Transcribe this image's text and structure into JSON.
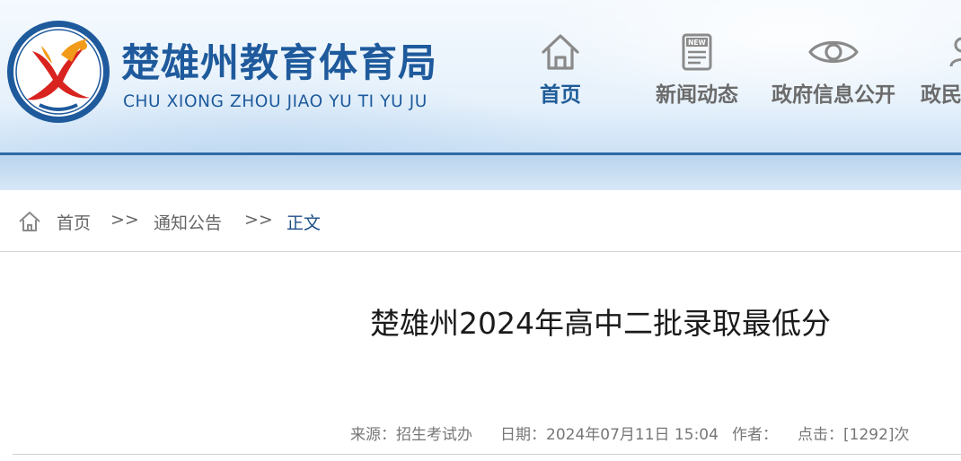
{
  "site": {
    "name": "楚雄州教育体育局",
    "pinyin": "CHU XIONG ZHOU JIAO YU TI YU JU",
    "logo_ring_text": "楚雄彝族自治州教育体育局",
    "colors": {
      "brand_blue": "#1e5a9c",
      "rule_blue": "#2d6aa6",
      "logo_red": "#d8231f",
      "logo_orange": "#f29a1a"
    }
  },
  "nav": [
    {
      "label": "首页",
      "icon": "house-icon",
      "active": true
    },
    {
      "label": "新闻动态",
      "icon": "newspaper-icon",
      "icon_text": "NEW",
      "active": false
    },
    {
      "label": "政府信息公开",
      "icon": "eye-icon",
      "active": false
    },
    {
      "label": "政民",
      "icon": "people-icon",
      "active": false
    }
  ],
  "breadcrumb": {
    "icon": "home-icon",
    "home": "首页",
    "sep1": ">>",
    "section": "通知公告",
    "sep2": ">>",
    "current": "正文"
  },
  "article": {
    "title": "楚雄州2024年高中二批录取最低分",
    "meta": {
      "source": "来源：招生考试办",
      "date": "日期：2024年07月11日 15:04",
      "author": "作者：",
      "views": "点击：[1292]次"
    }
  }
}
